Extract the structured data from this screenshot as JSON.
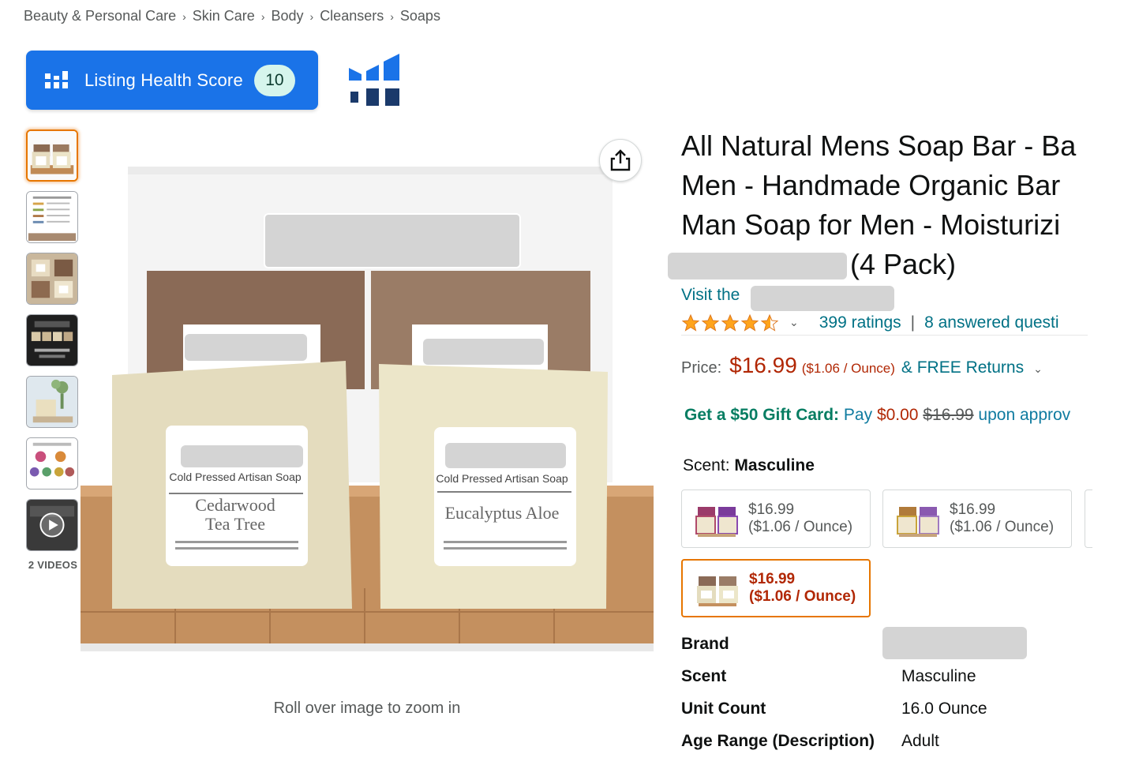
{
  "breadcrumb": [
    "Beauty & Personal Care",
    "Skin Care",
    "Body",
    "Cleansers",
    "Soaps"
  ],
  "breadcrumb_separator": "›",
  "listing_health": {
    "label": "Listing Health Score",
    "score": "10",
    "color": "#1a73e8"
  },
  "thumbnails": [
    {
      "name": "product-front"
    },
    {
      "name": "ingredients-chart"
    },
    {
      "name": "four-bars-grid"
    },
    {
      "name": "gift-box"
    },
    {
      "name": "lifestyle-plant"
    },
    {
      "name": "scent-options"
    },
    {
      "name": "video"
    }
  ],
  "videos_label": "2 VIDEOS",
  "main_image": {
    "label_left": {
      "line1": "Cold Pressed Artisan Soap",
      "line2a": "Cedarwood",
      "line2b": "Tea Tree"
    },
    "label_right": {
      "line1": "Cold Pressed Artisan Soap",
      "line2": "Eucalyptus Aloe"
    }
  },
  "zoom_hint": "Roll over image to zoom in",
  "product": {
    "title_lines": [
      "All Natural Mens Soap Bar - Ba",
      "Men - Handmade Organic Bar",
      "Man Soap for Men - Moisturizi"
    ],
    "title_tail": "(4 Pack)",
    "visit_prefix": "Visit the",
    "rating_chevron": "⌄",
    "ratings_count": "399 ratings",
    "pipe": "|",
    "answered": "8 answered questi",
    "price_label": "Price:",
    "price": "$16.99",
    "price_unit": "($1.06 / Ounce)",
    "returns": "& FREE Returns",
    "returns_chevron": "⌄",
    "gift_highlight": "Get a $50 Gift Card:",
    "gift_pay": "Pay",
    "gift_free": "$0.00",
    "gift_strike": "$16.99",
    "gift_rest": "upon approv",
    "scent_label": "Scent:",
    "scent_value": "Masculine",
    "swatches": [
      {
        "price": "$16.99",
        "unit": "($1.06 / Ounce)",
        "selected": false
      },
      {
        "price": "$16.99",
        "unit": "($1.06 / Ounce)",
        "selected": false
      },
      {
        "price": "$16.99",
        "unit": "($1.06 / Ounce)",
        "selected": true
      }
    ],
    "specs": [
      {
        "key": "Brand",
        "value": ""
      },
      {
        "key": "Scent",
        "value": "Masculine"
      },
      {
        "key": "Unit Count",
        "value": "16.0 Ounce"
      },
      {
        "key": "Age Range (Description)",
        "value": "Adult"
      }
    ]
  },
  "colors": {
    "link": "#007185",
    "price": "#b12704",
    "selected_border": "#e77600",
    "gift_green": "#067d62",
    "star": "#ffa41c"
  },
  "icons": [
    "bar-chart-icon",
    "share-icon",
    "star-icon",
    "play-icon",
    "chevron-down-icon"
  ]
}
